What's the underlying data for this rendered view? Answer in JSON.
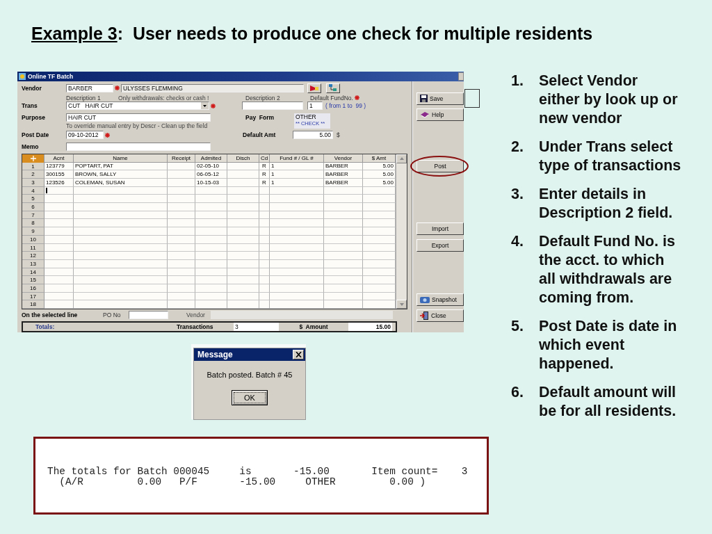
{
  "slide_title": {
    "label": "Example 3",
    "text": ":  User needs to produce one check for multiple residents"
  },
  "window": {
    "title": "Online TF Batch",
    "form": {
      "vendor_label": "Vendor",
      "vendor_code": "BARBER",
      "vendor_name": "ULYSSES FLEMMING",
      "desc1_label": "Description 1",
      "desc1_note": "Only withdrawals: checks or cash !",
      "desc2_label": "Description 2",
      "fund_label": "Default FundNo.",
      "trans_label": "Trans",
      "trans_value": "CUT   HAIR CUT",
      "fund_value": "1",
      "fund_range": "( from 1 to  99 )",
      "purpose_label": "Purpose",
      "purpose_value": "HAIR CUT",
      "pay_form_label": "Pay  Form",
      "pay_form_lines": [
        "OTHER",
        "** CHECK **"
      ],
      "hint": "To override manual entry by Descr - Clean up the field",
      "post_date_label": "Post Date",
      "post_date": "09-10-2012",
      "default_amt_label": "Default Amt",
      "default_amt": "5.00",
      "currency": "$",
      "memo_label": "Memo"
    },
    "grid": {
      "columns": [
        "Acnt",
        "Name",
        "Receipt",
        "Admited",
        "Disch",
        "Cd",
        "Fund # / GL #",
        "Vendor",
        "$ Amt"
      ],
      "rows": [
        {
          "number": "1",
          "cursor": false,
          "cells": {
            "acnt": "123779",
            "name": "POPTART, PAT",
            "admited": "02-05-10",
            "cd": "R",
            "fund": "1",
            "vendor": "BARBER",
            "amt": "5.00"
          }
        },
        {
          "number": "2",
          "cursor": false,
          "cells": {
            "acnt": "300155",
            "name": "BROWN, SALLY",
            "admited": "06-05-12",
            "cd": "R",
            "fund": "1",
            "vendor": "BARBER",
            "amt": "5.00"
          }
        },
        {
          "number": "3",
          "cursor": false,
          "cells": {
            "acnt": "123526",
            "name": "COLEMAN, SUSAN",
            "admited": "10-15-03",
            "cd": "R",
            "fund": "1",
            "vendor": "BARBER",
            "amt": "5.00"
          }
        },
        {
          "number": "4",
          "cursor": true
        },
        {
          "number": "5",
          "cursor": false
        },
        {
          "number": "6",
          "cursor": false
        },
        {
          "number": "7",
          "cursor": false
        },
        {
          "number": "8",
          "cursor": false
        },
        {
          "number": "9",
          "cursor": false
        },
        {
          "number": "10",
          "cursor": false
        },
        {
          "number": "11",
          "cursor": false
        },
        {
          "number": "12",
          "cursor": false
        },
        {
          "number": "13",
          "cursor": false
        },
        {
          "number": "14",
          "cursor": false
        },
        {
          "number": "15",
          "cursor": false
        },
        {
          "number": "16",
          "cursor": false
        },
        {
          "number": "17",
          "cursor": false
        },
        {
          "number": "18",
          "cursor": false
        }
      ]
    },
    "selected_line": {
      "label": "On the selected line",
      "po_label": "PO No",
      "vendor_label": "Vendor"
    },
    "totals": {
      "label": "Totals:",
      "transactions_label": "Transactions",
      "transactions": "3",
      "amount_label": "$  Amount",
      "amount": "15.00"
    },
    "side_buttons": [
      {
        "label": "Save",
        "kind": "save",
        "circled": false
      },
      {
        "label": "Help",
        "kind": "help",
        "circled": false
      },
      {
        "label": "Post",
        "kind": "plain",
        "circled": true
      },
      {
        "label": "Import",
        "kind": "plain",
        "circled": false
      },
      {
        "label": "Export",
        "kind": "plain",
        "circled": false
      },
      {
        "label": "Snapshot",
        "kind": "snapshot",
        "circled": false
      },
      {
        "label": "Close",
        "kind": "close",
        "circled": false
      }
    ]
  },
  "message": {
    "title": "Message",
    "text": "Batch posted. Batch # 45",
    "button": "OK"
  },
  "report": {
    "lines": [
      "The totals for Batch 000045     is       -15.00       Item count=    3",
      "  (A/R         0.00   P/F       -15.00     OTHER         0.00 )"
    ]
  },
  "steps": [
    {
      "number": "1.",
      "text": "Select Vendor either by look up or new vendor"
    },
    {
      "number": "2.",
      "text": "Under Trans select type of transactions"
    },
    {
      "number": "3.",
      "text": "Enter details in Description 2 field."
    },
    {
      "number": "4.",
      "text": "Default Fund No. is the acct. to which all withdrawals are coming from."
    },
    {
      "number": "5.",
      "text": "Post Date is date in which event happened."
    },
    {
      "number": "6.",
      "text": "Default amount will be for all residents."
    }
  ]
}
